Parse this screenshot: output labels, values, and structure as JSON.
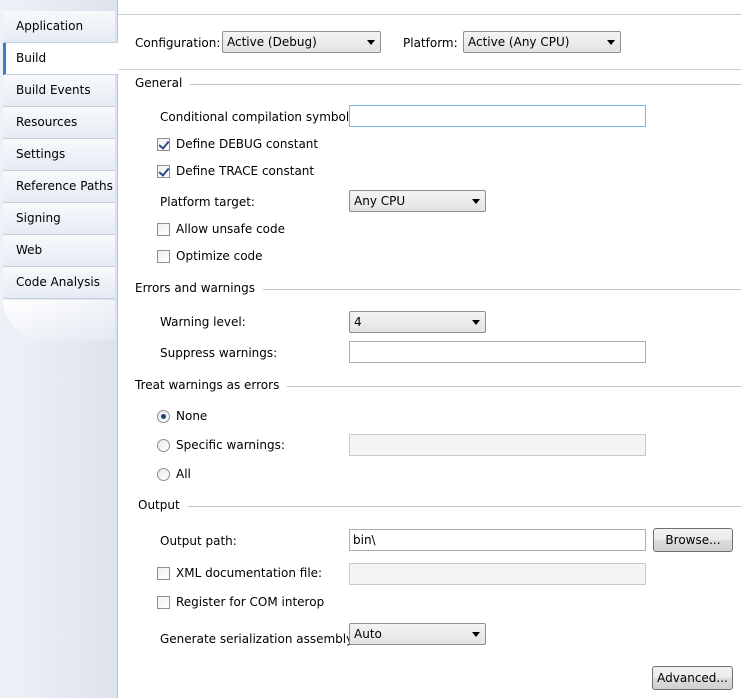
{
  "tabs": [
    {
      "label": "Application",
      "active": false
    },
    {
      "label": "Build",
      "active": true
    },
    {
      "label": "Build Events",
      "active": false
    },
    {
      "label": "Resources",
      "active": false
    },
    {
      "label": "Settings",
      "active": false
    },
    {
      "label": "Reference Paths",
      "active": false
    },
    {
      "label": "Signing",
      "active": false
    },
    {
      "label": "Web",
      "active": false
    },
    {
      "label": "Code Analysis",
      "active": false
    }
  ],
  "topbar": {
    "configuration_label": "Configuration:",
    "configuration_value": "Active (Debug)",
    "platform_label": "Platform:",
    "platform_value": "Active (Any CPU)"
  },
  "general": {
    "title": "General",
    "conditional_symbols_label": "Conditional compilation symbols:",
    "conditional_symbols_value": "",
    "define_debug_label": "Define DEBUG constant",
    "define_debug_checked": true,
    "define_trace_label": "Define TRACE constant",
    "define_trace_checked": true,
    "platform_target_label": "Platform target:",
    "platform_target_value": "Any CPU",
    "allow_unsafe_label": "Allow unsafe code",
    "allow_unsafe_checked": false,
    "optimize_label": "Optimize code",
    "optimize_checked": false
  },
  "errors": {
    "title": "Errors and warnings",
    "warning_level_label": "Warning level:",
    "warning_level_value": "4",
    "suppress_label": "Suppress warnings:",
    "suppress_value": ""
  },
  "treat": {
    "title": "Treat warnings as errors",
    "none_label": "None",
    "specific_label": "Specific warnings:",
    "specific_value": "",
    "all_label": "All",
    "selected": "none"
  },
  "output": {
    "title": "Output",
    "path_label": "Output path:",
    "path_value": "bin\\",
    "browse_label": "Browse...",
    "xml_doc_label": "XML documentation file:",
    "xml_doc_checked": false,
    "xml_doc_value": "",
    "com_interop_label": "Register for COM interop",
    "com_interop_checked": false,
    "serialization_label": "Generate serialization assembly:",
    "serialization_value": "Auto",
    "advanced_label": "Advanced..."
  }
}
